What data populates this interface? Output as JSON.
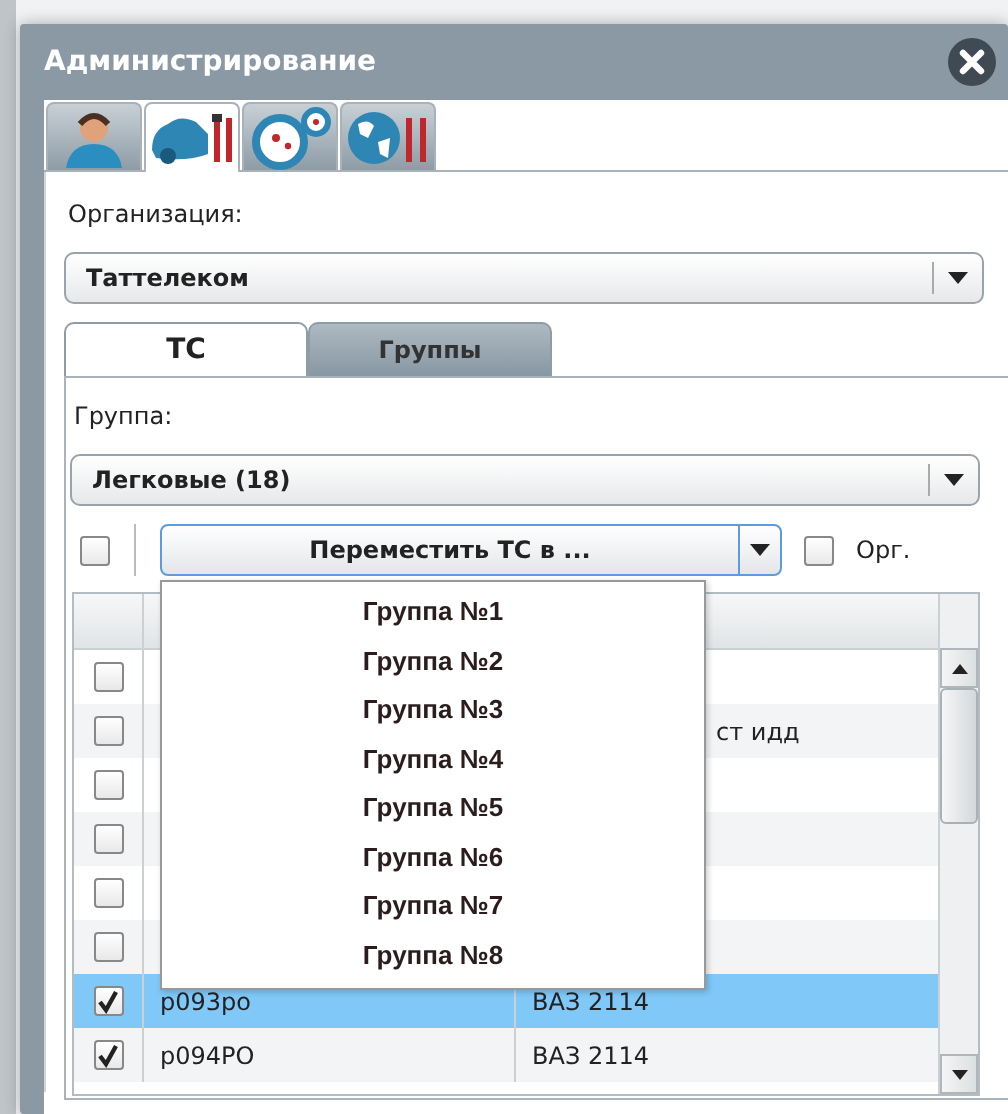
{
  "window": {
    "title": "Администрирование"
  },
  "icon_tabs": [
    {
      "kind": "operator",
      "selected": false
    },
    {
      "kind": "car-tools",
      "selected": true
    },
    {
      "kind": "dials",
      "selected": false
    },
    {
      "kind": "globe-tools",
      "selected": false
    }
  ],
  "organization": {
    "label": "Организация:",
    "value": "Таттелеком"
  },
  "tabs": [
    {
      "label": "ТС",
      "selected": true
    },
    {
      "label": "Группы",
      "selected": false
    }
  ],
  "group": {
    "label": "Группа:",
    "value": "Легковые (18)"
  },
  "toolbar": {
    "select_all_checked": false,
    "move_button": "Переместить ТС в ...",
    "org_label": "Орг.",
    "org_checked": false
  },
  "move_menu": {
    "items": [
      "Группа №1",
      "Группа №2",
      "Группа №3",
      "Группа №4",
      "Группа №5",
      "Группа №6",
      "Группа №7",
      "Группа №8"
    ]
  },
  "table": {
    "rows": [
      {
        "checked": false,
        "selected": false
      },
      {
        "checked": false,
        "selected": false,
        "column_2": "ст идд"
      },
      {
        "checked": false,
        "selected": false
      },
      {
        "checked": false,
        "selected": false
      },
      {
        "checked": false,
        "selected": false
      },
      {
        "checked": false,
        "selected": false
      },
      {
        "checked": true,
        "selected": true,
        "column_1": "р093ро",
        "column_2": "ВАЗ 2114"
      },
      {
        "checked": true,
        "selected": false,
        "column_1": "р094РО",
        "column_2": "ВАЗ 2114"
      }
    ]
  }
}
